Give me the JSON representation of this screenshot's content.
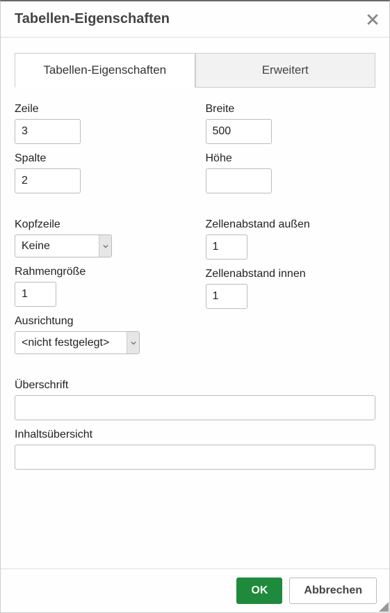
{
  "dialog": {
    "title": "Tabellen-Eigenschaften"
  },
  "tabs": {
    "general": "Tabellen-Eigenschaften",
    "advanced": "Erweitert"
  },
  "fields": {
    "rows": {
      "label": "Zeile",
      "value": "3"
    },
    "cols": {
      "label": "Spalte",
      "value": "2"
    },
    "width": {
      "label": "Breite",
      "value": "500"
    },
    "height": {
      "label": "Höhe",
      "value": ""
    },
    "headers": {
      "label": "Kopfzeile",
      "value": "Keine"
    },
    "border": {
      "label": "Rahmengröße",
      "value": "1"
    },
    "align": {
      "label": "Ausrichtung",
      "value": "<nicht festgelegt>"
    },
    "cellspacing": {
      "label": "Zellenabstand außen",
      "value": "1"
    },
    "cellpadding": {
      "label": "Zellenabstand innen",
      "value": "1"
    },
    "caption": {
      "label": "Überschrift",
      "value": ""
    },
    "summary": {
      "label": "Inhaltsübersicht",
      "value": ""
    }
  },
  "buttons": {
    "ok": "OK",
    "cancel": "Abbrechen"
  }
}
